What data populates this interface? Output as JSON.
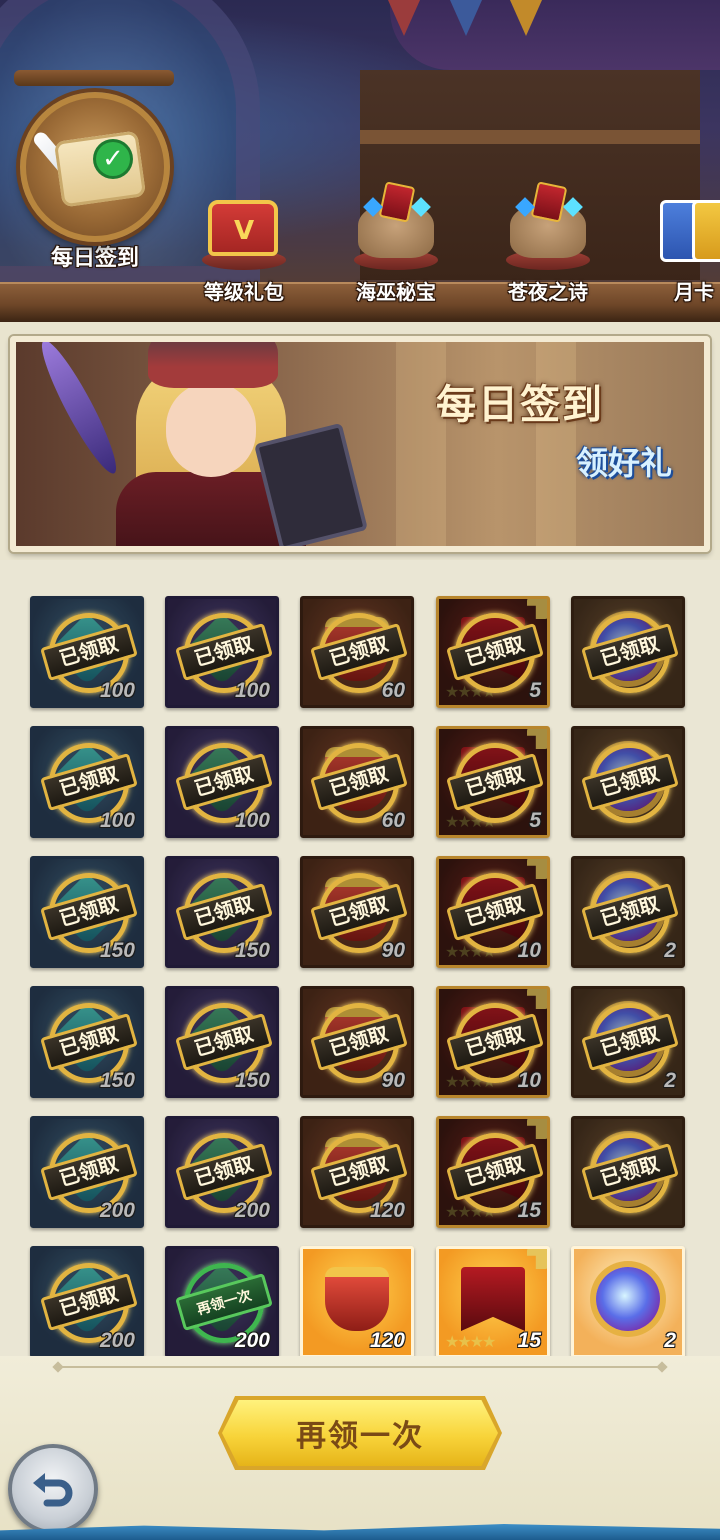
{
  "tabs": [
    {
      "label": "每日签到",
      "active": true,
      "icon": "daily-checkin-scroll-icon"
    },
    {
      "label": "等级礼包",
      "active": false,
      "icon": "treasure-chest-icon"
    },
    {
      "label": "海巫秘宝",
      "active": false,
      "icon": "gem-sack-icon"
    },
    {
      "label": "苍夜之诗",
      "active": false,
      "icon": "gem-sack-icon"
    },
    {
      "label": "月卡",
      "active": false,
      "icon": "month-card-icon"
    }
  ],
  "banner": {
    "title": "每日签到",
    "subtitle": "领好礼"
  },
  "grid": {
    "claimed_stamp": "已领取",
    "claim_again_stamp": "再领一次",
    "rows": [
      [
        {
          "type": "blue",
          "item": "gem-blue",
          "qty": "100",
          "state": "claimed"
        },
        {
          "type": "purple",
          "item": "gem-green",
          "qty": "100",
          "state": "claimed"
        },
        {
          "type": "red",
          "item": "crown",
          "qty": "60",
          "state": "claimed"
        },
        {
          "type": "dark",
          "item": "banner-red",
          "qty": "5",
          "state": "claimed",
          "stars": true
        },
        {
          "type": "gold",
          "item": "orb",
          "qty": "",
          "state": "claimed"
        }
      ],
      [
        {
          "type": "blue",
          "item": "gem-blue",
          "qty": "100",
          "state": "claimed"
        },
        {
          "type": "purple",
          "item": "gem-green",
          "qty": "100",
          "state": "claimed"
        },
        {
          "type": "red",
          "item": "crown",
          "qty": "60",
          "state": "claimed"
        },
        {
          "type": "dark",
          "item": "banner-red",
          "qty": "5",
          "state": "claimed",
          "stars": true
        },
        {
          "type": "gold",
          "item": "orb",
          "qty": "",
          "state": "claimed"
        }
      ],
      [
        {
          "type": "blue",
          "item": "gem-blue",
          "qty": "150",
          "state": "claimed"
        },
        {
          "type": "purple",
          "item": "gem-green",
          "qty": "150",
          "state": "claimed"
        },
        {
          "type": "red",
          "item": "crown",
          "qty": "90",
          "state": "claimed"
        },
        {
          "type": "dark",
          "item": "banner-red",
          "qty": "10",
          "state": "claimed",
          "stars": true
        },
        {
          "type": "gold",
          "item": "orb",
          "qty": "2",
          "state": "claimed"
        }
      ],
      [
        {
          "type": "blue",
          "item": "gem-blue",
          "qty": "150",
          "state": "claimed"
        },
        {
          "type": "purple",
          "item": "gem-green",
          "qty": "150",
          "state": "claimed"
        },
        {
          "type": "red",
          "item": "crown",
          "qty": "90",
          "state": "claimed"
        },
        {
          "type": "dark",
          "item": "banner-red",
          "qty": "10",
          "state": "claimed",
          "stars": true
        },
        {
          "type": "gold",
          "item": "orb",
          "qty": "2",
          "state": "claimed"
        }
      ],
      [
        {
          "type": "blue",
          "item": "gem-blue",
          "qty": "200",
          "state": "claimed"
        },
        {
          "type": "purple",
          "item": "gem-green",
          "qty": "200",
          "state": "claimed"
        },
        {
          "type": "red",
          "item": "crown",
          "qty": "120",
          "state": "claimed"
        },
        {
          "type": "dark",
          "item": "banner-red",
          "qty": "15",
          "state": "claimed",
          "stars": true
        },
        {
          "type": "gold",
          "item": "orb",
          "qty": "",
          "state": "claimed"
        }
      ],
      [
        {
          "type": "blue",
          "item": "gem-blue",
          "qty": "200",
          "state": "claimed"
        },
        {
          "type": "purple",
          "item": "gem-green",
          "qty": "200",
          "state": "claim-again"
        },
        {
          "type": "orange",
          "item": "crown",
          "qty": "120",
          "state": "available"
        },
        {
          "type": "orange",
          "item": "banner-red",
          "qty": "15",
          "state": "available",
          "stars": true
        },
        {
          "type": "lilac",
          "item": "orb",
          "qty": "2",
          "state": "available"
        }
      ]
    ]
  },
  "bottom": {
    "claim_again_button": "再领一次",
    "back_icon": "back-arrow-icon"
  },
  "colors": {
    "accent_gold": "#f8d43a",
    "claimed_ring": "#e2b441",
    "claim_again_green": "#3fb64f"
  }
}
